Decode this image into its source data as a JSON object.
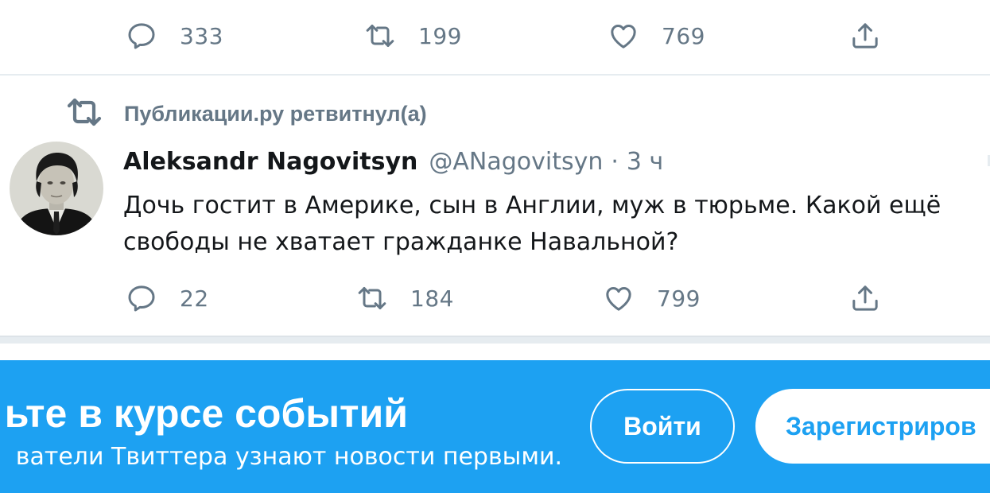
{
  "previous_tweet": {
    "actions": {
      "reply_count": "333",
      "retweet_count": "199",
      "like_count": "769"
    }
  },
  "retweet_context": {
    "text": "Публикации.ру ретвитнул(а)"
  },
  "tweet": {
    "author_name": "Aleksandr Nagovitsyn",
    "author_handle": "@ANagovitsyn",
    "separator": "·",
    "time": "3 ч",
    "text_line1": "Дочь гостит в Америке, сын в Англии, муж в тюрьме. Какой ещё",
    "text_line2": "свободы не хватает гражданке Навальной?",
    "actions": {
      "reply_count": "22",
      "retweet_count": "184",
      "like_count": "799"
    }
  },
  "banner": {
    "title": "ьте в курсе событий",
    "subtitle": "ватели Твиттера узнают новости первыми.",
    "login_label": "Войти",
    "signup_label": "Зарегистриров"
  },
  "colors": {
    "brand_blue": "#1da1f2",
    "icon_gray": "#657786",
    "text_dark": "#14171a",
    "divider": "#e6ecf0"
  },
  "icons": [
    "reply-icon",
    "retweet-icon",
    "like-icon",
    "share-icon",
    "avatar"
  ]
}
